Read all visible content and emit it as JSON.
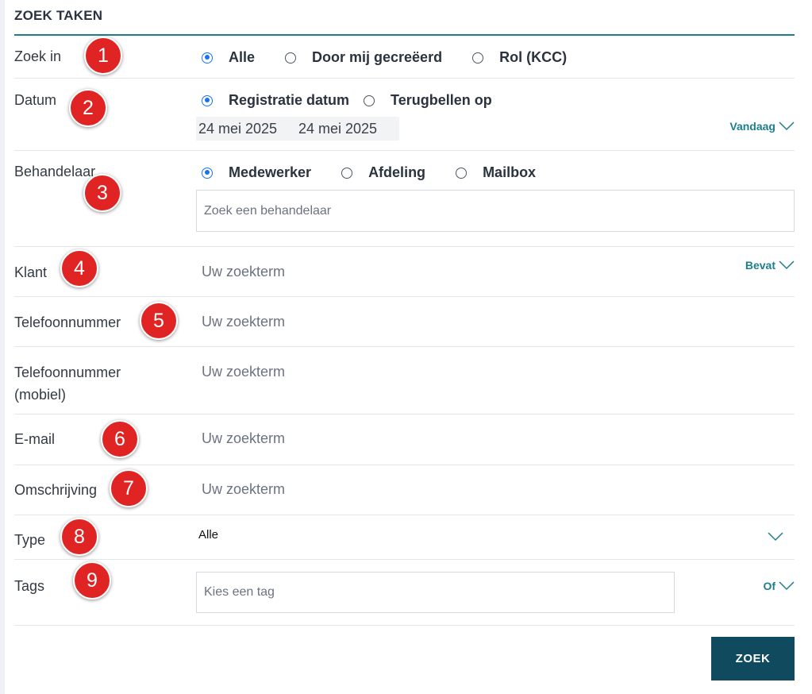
{
  "title": "ZOEK TAKEN",
  "zoek_in": {
    "label": "Zoek in",
    "options": [
      "Alle",
      "Door mij gecreëerd",
      "Rol (KCC)"
    ],
    "selected": "Alle",
    "badge": "1"
  },
  "datum": {
    "label": "Datum",
    "options": [
      "Registratie datum",
      "Terugbellen op"
    ],
    "selected": "Registratie datum",
    "from": "24 mei 2025",
    "to": "24 mei 2025",
    "range": "Vandaag",
    "badge": "2"
  },
  "behandelaar": {
    "label": "Behandelaar",
    "options": [
      "Medewerker",
      "Afdeling",
      "Mailbox"
    ],
    "selected": "Medewerker",
    "placeholder": "Zoek een behandelaar",
    "badge": "3"
  },
  "klant": {
    "label": "Klant",
    "placeholder": "Uw zoekterm",
    "mode": "Bevat",
    "badge": "4"
  },
  "telefoon": {
    "label": "Telefoonnummer",
    "placeholder": "Uw zoekterm",
    "badge": "5"
  },
  "mobiel": {
    "label_line1": "Telefoonnummer",
    "label_line2": "(mobiel)",
    "placeholder": "Uw zoekterm"
  },
  "email": {
    "label": "E-mail",
    "placeholder": "Uw zoekterm",
    "badge": "6"
  },
  "omschrijving": {
    "label": "Omschrijving",
    "placeholder": "Uw zoekterm",
    "badge": "7"
  },
  "type": {
    "label": "Type",
    "value": "Alle",
    "badge": "8"
  },
  "tags": {
    "label": "Tags",
    "placeholder": "Kies een tag",
    "mode": "Of",
    "badge": "9"
  },
  "search_button": "ZOEK",
  "colors": {
    "accent": "#1d7f8c",
    "radio": "#1a73e8",
    "badge": "#e02424",
    "button": "#0f4a5e"
  },
  "icons": {
    "dropdown": "chevron-down-icon"
  }
}
